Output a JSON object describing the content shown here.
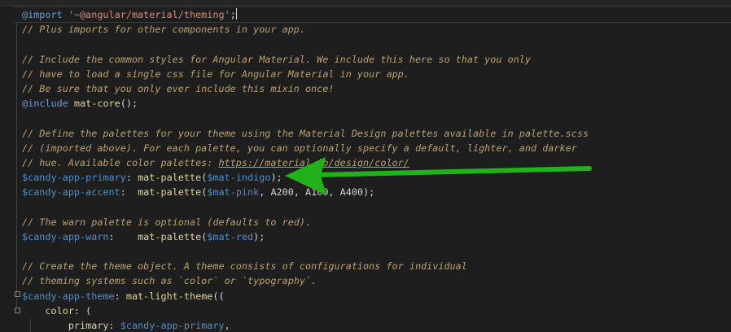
{
  "code_lines": [
    [
      {
        "t": "@import",
        "c": "keyword"
      },
      {
        "t": " '~@angular/material/theming'",
        "c": "str"
      },
      {
        "t": ";",
        "c": "plain"
      },
      {
        "cursor": true
      }
    ],
    [
      {
        "t": "// Plus imports for other components in your app.",
        "c": "comment"
      }
    ],
    [],
    [
      {
        "t": "// Include the common styles for Angular Material. We include this here so that you only",
        "c": "comment"
      }
    ],
    [
      {
        "t": "// have to load a single css file for Angular Material in your app.",
        "c": "comment"
      }
    ],
    [
      {
        "t": "// Be sure that you only ever include this mixin once!",
        "c": "comment"
      }
    ],
    [
      {
        "t": "@include",
        "c": "keyword"
      },
      {
        "t": " mat-core",
        "c": "func"
      },
      {
        "t": "();",
        "c": "plain"
      }
    ],
    [],
    [
      {
        "t": "// Define the palettes for your theme using the Material Design palettes available in palette.scss",
        "c": "comment"
      }
    ],
    [
      {
        "t": "// (imported above). For each palette, you can optionally specify a default, lighter, and darker",
        "c": "comment"
      }
    ],
    [
      {
        "t": "// hue. Available color palettes: ",
        "c": "comment"
      },
      {
        "t": "https://material.io/design/color/",
        "c": "link"
      }
    ],
    [
      {
        "t": "$candy-app-primary",
        "c": "var"
      },
      {
        "t": ": ",
        "c": "plain"
      },
      {
        "t": "mat-palette",
        "c": "func"
      },
      {
        "t": "(",
        "c": "plain"
      },
      {
        "t": "$mat-indigo",
        "c": "var"
      },
      {
        "t": ");",
        "c": "plain"
      }
    ],
    [
      {
        "t": "$candy-app-accent",
        "c": "var"
      },
      {
        "t": ":  ",
        "c": "plain"
      },
      {
        "t": "mat-palette",
        "c": "func"
      },
      {
        "t": "(",
        "c": "plain"
      },
      {
        "t": "$mat-pink",
        "c": "var"
      },
      {
        "t": ", A200, A100, A400);",
        "c": "plain"
      }
    ],
    [],
    [
      {
        "t": "// The warn palette is optional (defaults to red).",
        "c": "comment"
      }
    ],
    [
      {
        "t": "$candy-app-warn",
        "c": "var"
      },
      {
        "t": ":    ",
        "c": "plain"
      },
      {
        "t": "mat-palette",
        "c": "func"
      },
      {
        "t": "(",
        "c": "plain"
      },
      {
        "t": "$mat-red",
        "c": "var"
      },
      {
        "t": ");",
        "c": "plain"
      }
    ],
    [],
    [
      {
        "t": "// Create the theme object. A theme consists of configurations for individual",
        "c": "comment"
      }
    ],
    [
      {
        "t": "// theming systems such as `color` or `typography`.",
        "c": "comment"
      }
    ],
    [
      {
        "t": "$candy-app-theme",
        "c": "var"
      },
      {
        "t": ": ",
        "c": "plain"
      },
      {
        "t": "mat-light-theme",
        "c": "func"
      },
      {
        "t": "((",
        "c": "plain"
      }
    ],
    [
      {
        "t": "    color",
        "c": "func"
      },
      {
        "t": ": (",
        "c": "plain"
      }
    ],
    [
      {
        "t": "        primary",
        "c": "func"
      },
      {
        "t": ": ",
        "c": "plain"
      },
      {
        "t": "$candy-app-primary",
        "c": "var"
      },
      {
        "t": ",",
        "c": "plain"
      }
    ]
  ],
  "colors": {
    "background": "#1e1e1e",
    "arrow": "#22b11a",
    "comment": "#b9a06a",
    "keyword": "#6c9bd2",
    "variable": "#4e8fc7",
    "function": "#dcd3a0"
  }
}
